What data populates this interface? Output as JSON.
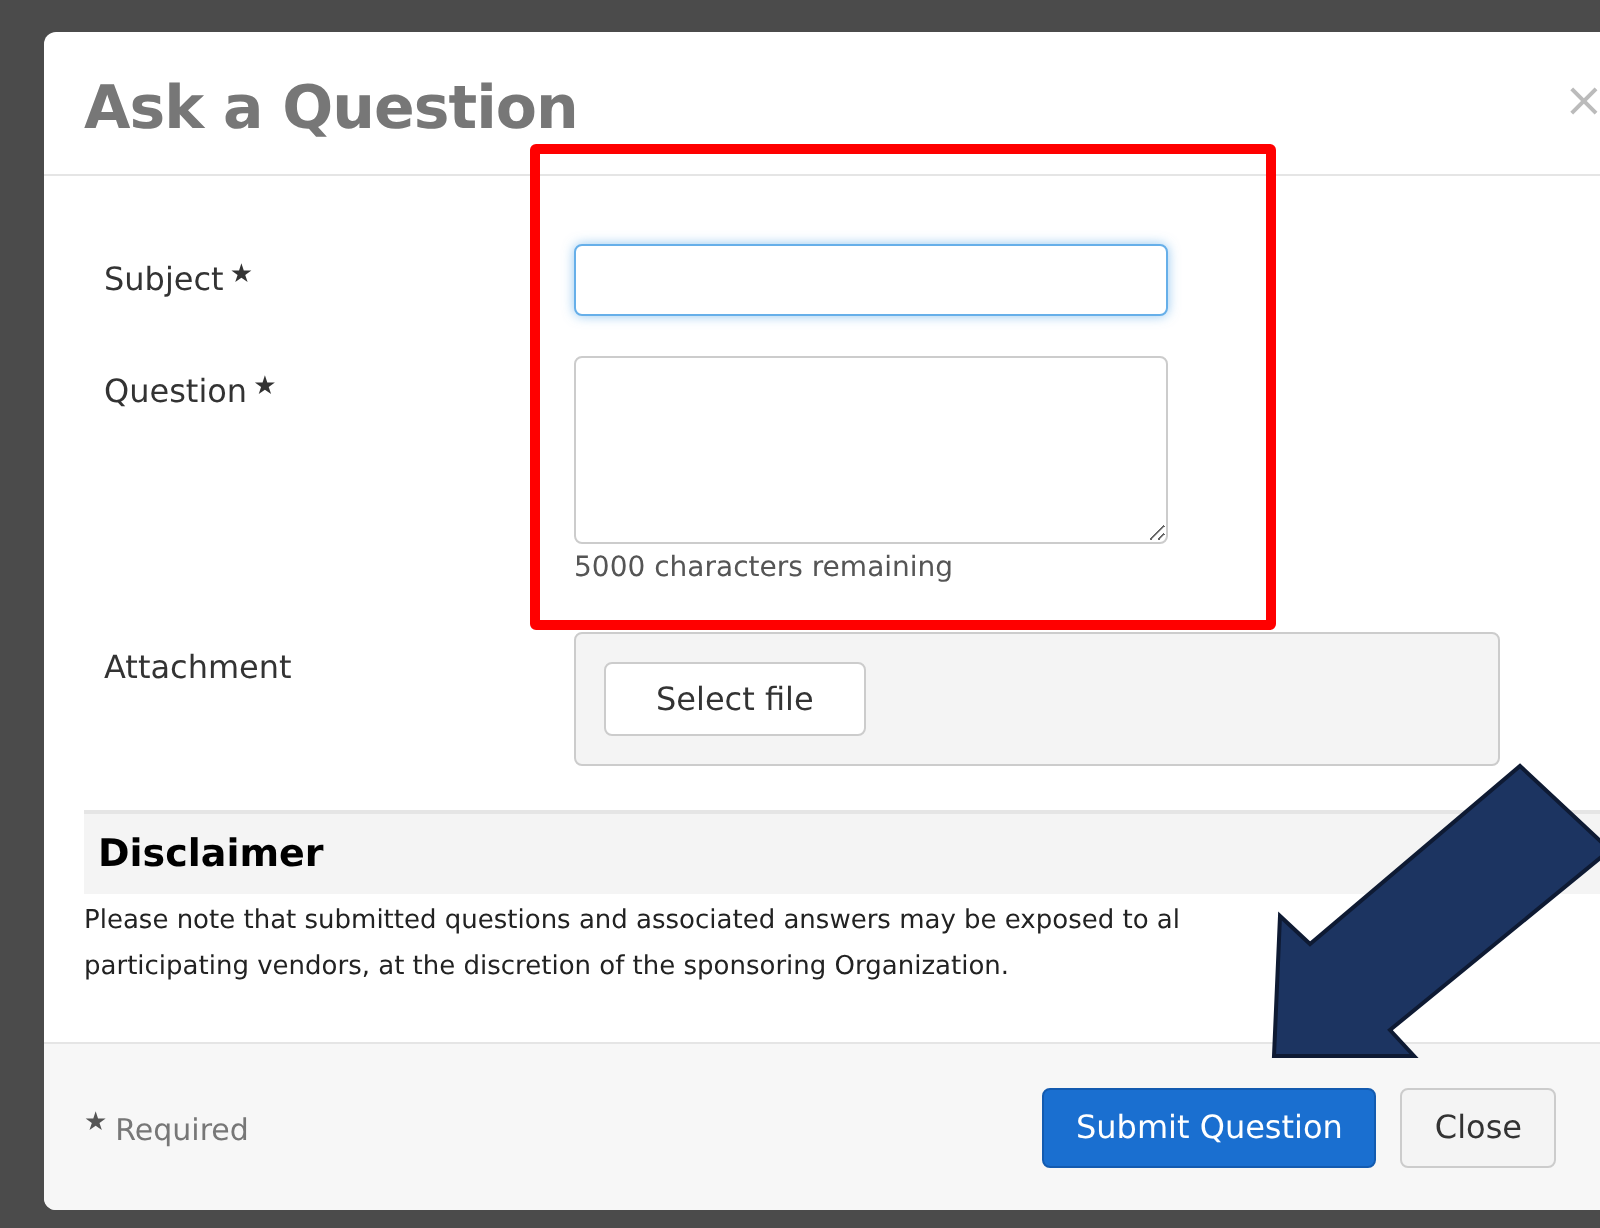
{
  "dialog": {
    "title": "Ask a Question",
    "close_glyph": "×"
  },
  "fields": [
    {
      "kind": "input",
      "label": "Subject",
      "required_mark": "★",
      "focused": true
    },
    {
      "kind": "textarea",
      "label": "Question",
      "required_mark": "★",
      "focused": false,
      "hint": "5000 characters remaining"
    },
    {
      "kind": "file",
      "label": "Attachment",
      "button": "Select file"
    }
  ],
  "disclaimer": {
    "heading": "Disclaimer",
    "lines": [
      "Please note that submitted questions and associated answers may be exposed to al",
      "participating vendors, at the discretion of the sponsoring Organization."
    ]
  },
  "footer": {
    "required_mark": "★",
    "required_note": "Required",
    "buttons": [
      {
        "label": "Submit Question",
        "kind": "primary"
      },
      {
        "label": "Close",
        "kind": "default"
      }
    ]
  }
}
